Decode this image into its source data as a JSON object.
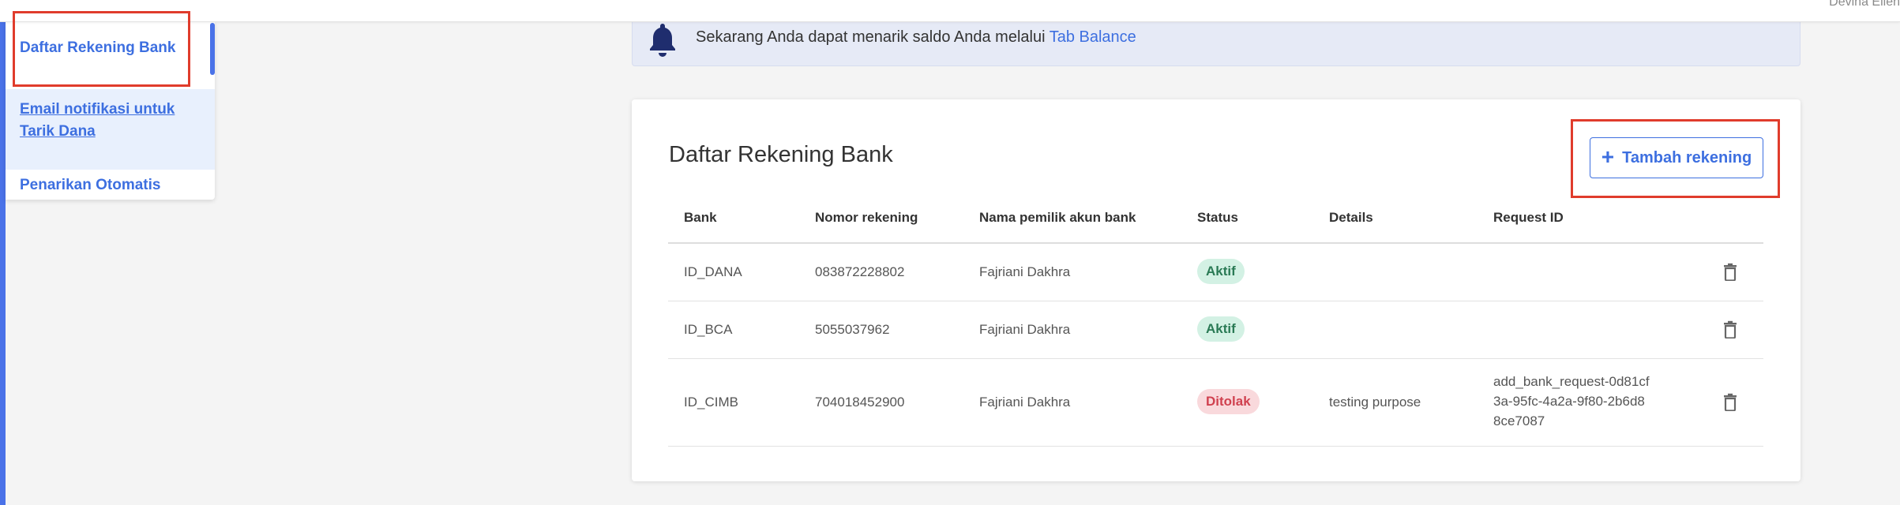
{
  "header": {
    "user_name": "Devina Ellen"
  },
  "sidebar": {
    "items": [
      {
        "label": "Daftar Rekening Bank"
      },
      {
        "label": "Email notifikasi untuk Tarik Dana"
      },
      {
        "label": "Penarikan Otomatis"
      }
    ]
  },
  "banner": {
    "text": "Sekarang Anda dapat menarik saldo Anda melalui ",
    "link": "Tab Balance",
    "icon": "bell-icon"
  },
  "card": {
    "title": "Daftar Rekening Bank",
    "add_button": {
      "label": "Tambah rekening",
      "icon": "plus-icon"
    }
  },
  "table": {
    "headers": [
      "Bank",
      "Nomor rekening",
      "Nama pemilik akun bank",
      "Status",
      "Details",
      "Request ID"
    ],
    "rows": [
      {
        "bank": "ID_DANA",
        "number": "083872228802",
        "owner": "Fajriani Dakhra",
        "status": "Aktif",
        "details": "",
        "request_id": ""
      },
      {
        "bank": "ID_BCA",
        "number": "5055037962",
        "owner": "Fajriani Dakhra",
        "status": "Aktif",
        "details": "",
        "request_id": ""
      },
      {
        "bank": "ID_CIMB",
        "number": "704018452900",
        "owner": "Fajriani Dakhra",
        "status": "Ditolak",
        "details": "testing purpose",
        "request_id": "add_bank_request-0d81cf3a-95fc-4a2a-9f80-2b6d88ce7087"
      }
    ]
  },
  "colors": {
    "accent": "#3d6fe0",
    "status_active_bg": "#d3f1e4",
    "status_active_text": "#2a7a55",
    "status_rejected_bg": "#f9d9dc",
    "status_rejected_text": "#d0414f",
    "highlight_box": "#e03c2c"
  }
}
